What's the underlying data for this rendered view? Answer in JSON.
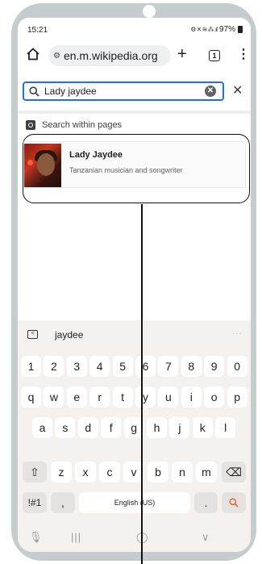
{
  "status": {
    "time": "15:21",
    "icons": "⚙ ✕ ≋ ⁂ .ıl",
    "battery": "97%"
  },
  "browser": {
    "url": "en.m.wikipedia.org",
    "tab_count": "1",
    "plus_label": "+",
    "menu_label": "⋮"
  },
  "search": {
    "query": "Lady jaydee",
    "clear_label": "✕",
    "close_label": "✕"
  },
  "within_pages": {
    "label": "Search within pages"
  },
  "result": {
    "title": "Lady Jaydee",
    "description": "Tanzanian musician and songwriter"
  },
  "keyboard": {
    "collapse_label": "<",
    "suggestion": "jaydee",
    "more_label": "···",
    "rows": [
      [
        "1",
        "2",
        "3",
        "4",
        "5",
        "6",
        "7",
        "8",
        "9",
        "0"
      ],
      [
        "q",
        "w",
        "e",
        "r",
        "t",
        "y",
        "u",
        "i",
        "o",
        "p"
      ],
      [
        "a",
        "s",
        "d",
        "f",
        "g",
        "h",
        "j",
        "k",
        "l"
      ],
      [
        "z",
        "x",
        "c",
        "v",
        "b",
        "n",
        "m"
      ]
    ],
    "shift_label": "⇧",
    "backspace_label": "⌫",
    "symbols_label": "!#1",
    "comma_label": ",",
    "space_label": "English (US)",
    "period_label": ".",
    "search_label": "⚲"
  },
  "navbar": {
    "mic_label": "🎙",
    "recents_label": "|||",
    "home_label": "◯",
    "back_label": "∨"
  }
}
